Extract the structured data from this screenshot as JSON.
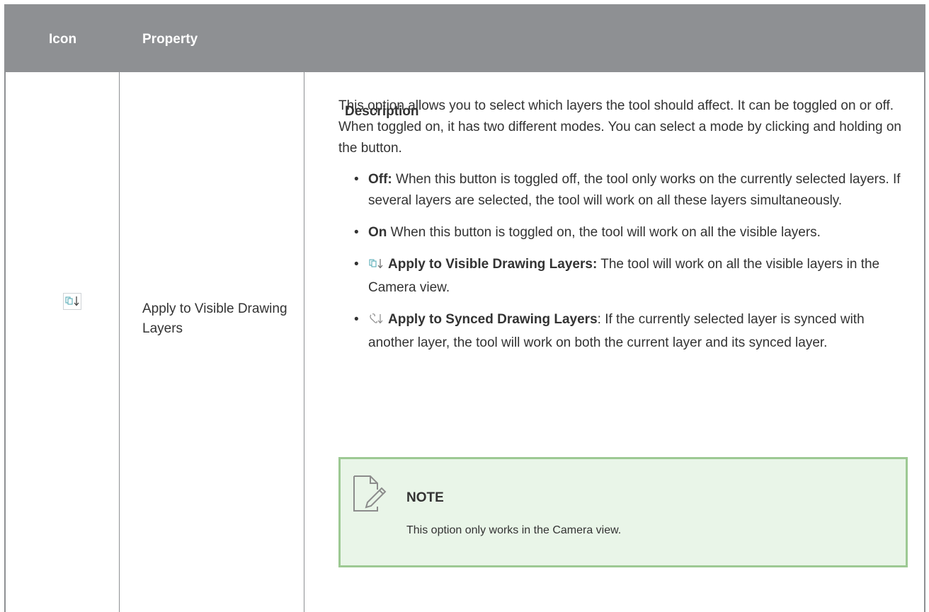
{
  "table": {
    "headers": {
      "icon": "Icon",
      "property": "Property",
      "description": "Description"
    },
    "row": {
      "icon_name": "apply-to-visible-drawing-layers-icon",
      "property": "Apply to Visible Drawing Layers",
      "intro": "This option allows you to select which layers the tool should affect. It can be toggled on or off. When toggled on, it has two different modes. You can select a mode by clicking and holding on the button.",
      "items": [
        {
          "label": "Off:",
          "text": " When this button is toggled off, the tool only works on the currently selected layers. If several layers are selected, the tool will work on all these layers simultaneously."
        },
        {
          "label": "On",
          "text": " When this button is toggled on, the tool will work on all the visible layers."
        },
        {
          "icon_name": "apply-to-visible-drawing-layers-icon",
          "label": "Apply to Visible Drawing Layers:",
          "text": " The tool will work on all the visible layers in the Camera view."
        },
        {
          "icon_name": "apply-to-synced-drawing-layers-icon",
          "label": "Apply to Synced Drawing Layers",
          "text": ": If the currently selected layer is synced with another layer, the tool will work on both the current layer and its synced layer."
        }
      ],
      "note": {
        "title": "NOTE",
        "body": "This option only works in the Camera view."
      }
    }
  },
  "colors": {
    "header_bg": "#8e9093",
    "note_bg": "#e9f5e8",
    "note_border": "#9dc993",
    "icon_teal": "#4aa5b0"
  }
}
